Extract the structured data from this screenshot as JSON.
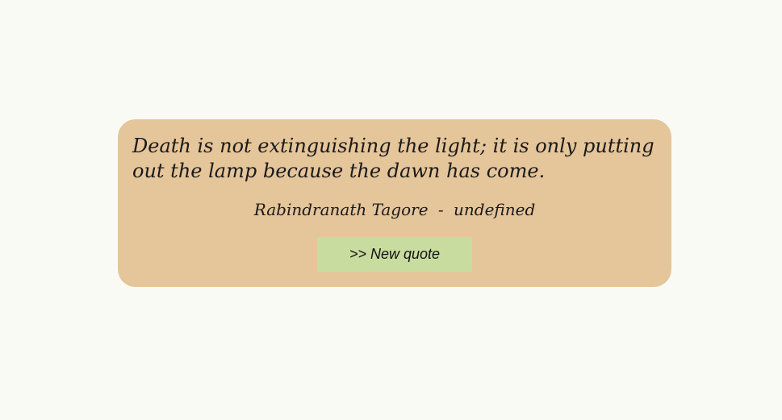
{
  "quote": {
    "text": "Death is not extinguishing the light; it is only putting out the lamp because the dawn has come.",
    "author": "Rabindranath Tagore",
    "separator": "-",
    "source": "undefined"
  },
  "actions": {
    "new_quote_label": ">> New quote"
  },
  "colors": {
    "page_background": "#fafaf5",
    "card_background": "#e5c59a",
    "button_background": "#c9dca0"
  }
}
